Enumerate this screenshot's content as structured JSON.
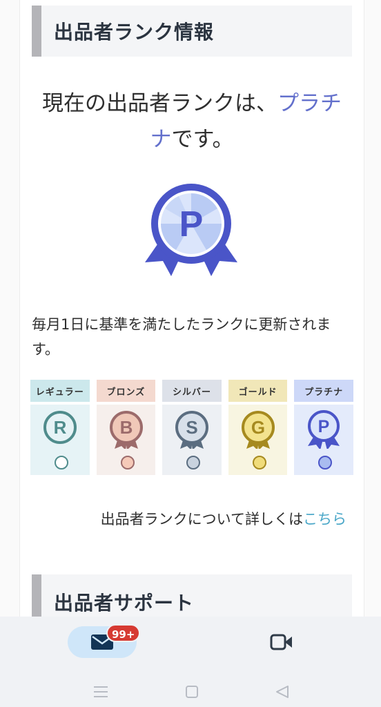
{
  "section1": {
    "title": "出品者ランク情報"
  },
  "rank_status": {
    "prefix": "現在の出品者ランクは、",
    "rank_name": "プラチナ",
    "suffix": "です。"
  },
  "current_medal": {
    "letter": "P",
    "color": "#4a55c8"
  },
  "description": "毎月1日に基準を満たしたランクに更新されます。",
  "ranks": [
    {
      "label": "レギュラー",
      "letter": "R",
      "header_bg": "#cce8ec",
      "body_bg": "#e6f3f6",
      "color": "#4f8c8c",
      "dot_fill": "#ffffff"
    },
    {
      "label": "ブロンズ",
      "letter": "B",
      "header_bg": "#f4d9cf",
      "body_bg": "#f6efec",
      "color": "#9c6b6b",
      "dot_fill": "#f5c9b8"
    },
    {
      "label": "シルバー",
      "letter": "S",
      "header_bg": "#dde1e9",
      "body_bg": "#edf0f4",
      "color": "#5b6d80",
      "dot_fill": "#c8d2de"
    },
    {
      "label": "ゴールド",
      "letter": "G",
      "header_bg": "#f1e7b8",
      "body_bg": "#f8f5e1",
      "color": "#a68a1f",
      "dot_fill": "#f0dc7a"
    },
    {
      "label": "プラチナ",
      "letter": "P",
      "header_bg": "#cdd8f8",
      "body_bg": "#e4ebfb",
      "color": "#4a55c8",
      "dot_fill": "#a9bcf0"
    }
  ],
  "rank_info_link": {
    "text": "出品者ランクについて詳しくは",
    "link_text": "こちら"
  },
  "section2": {
    "title": "出品者サポート"
  },
  "bottom_nav": {
    "mail_icon": "mail-icon",
    "mail_badge": "99+",
    "video_icon": "video-icon"
  },
  "system_nav": {
    "menu_icon": "menu-icon",
    "home_icon": "home-icon",
    "back_icon": "back-icon"
  }
}
